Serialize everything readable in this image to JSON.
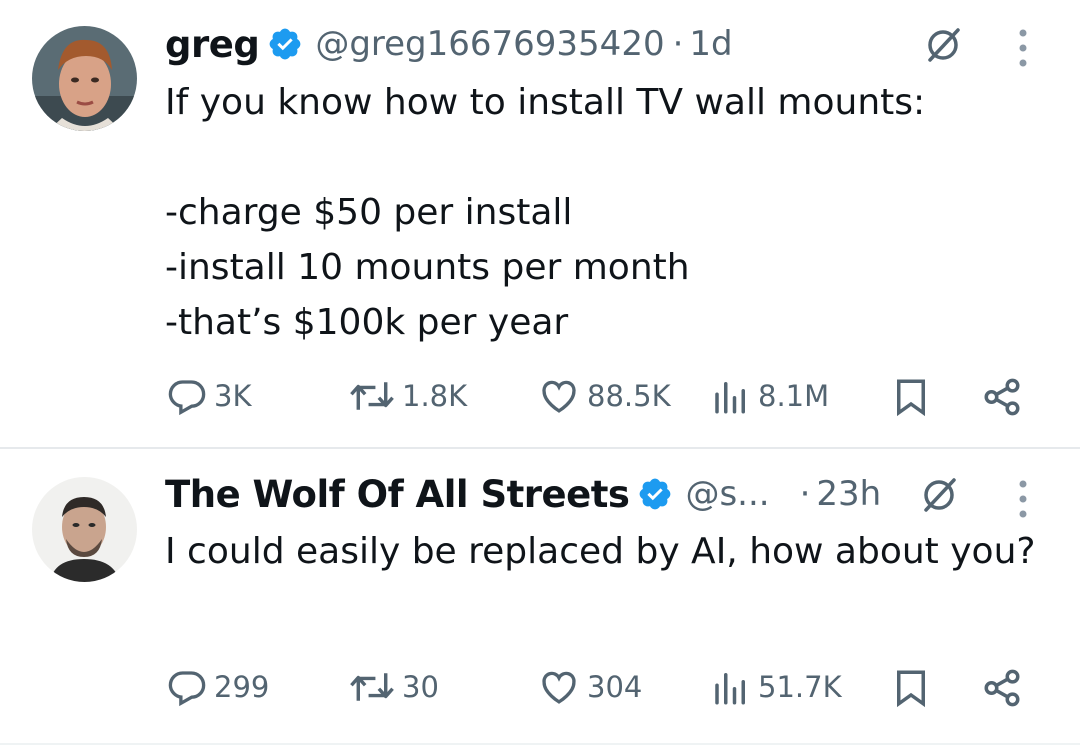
{
  "tweets": [
    {
      "name": "greg",
      "handle": "@greg16676935420",
      "separator": "·",
      "time": "1d",
      "lines": [
        "If you know how to install TV wall mounts:",
        "",
        "-charge $50 per install",
        "-install 10 mounts per month",
        "-that’s $100k per year"
      ],
      "stats": {
        "replies": "3K",
        "reposts": "1.8K",
        "likes": "88.5K",
        "views": "8.1M"
      }
    },
    {
      "name": "The Wolf Of All Streets",
      "handle": "@s...",
      "separator": "·",
      "time": "23h",
      "lines": [
        "I could easily be replaced by AI, how about you?"
      ],
      "stats": {
        "replies": "299",
        "reposts": "30",
        "likes": "304",
        "views": "51.7K"
      }
    }
  ],
  "icons": {
    "verified": "verified-badge-icon",
    "grok": "grok-icon",
    "more": "more-options-icon",
    "reply": "reply-icon",
    "repost": "repost-icon",
    "like": "like-icon",
    "views": "views-icon",
    "bookmark": "bookmark-icon",
    "share": "share-icon"
  },
  "colors": {
    "verified": "#1d9bf0",
    "secondary_text": "#536471",
    "text": "#0f1419"
  }
}
